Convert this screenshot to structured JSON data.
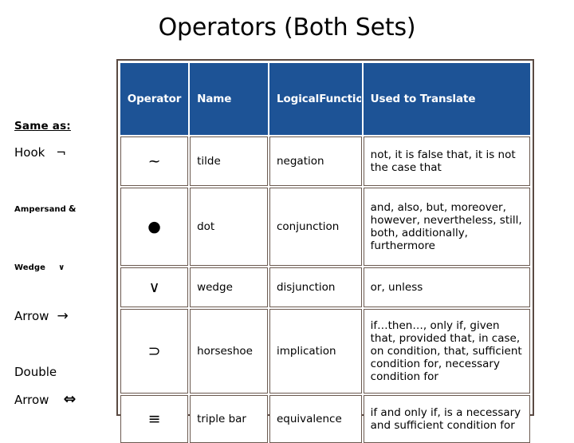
{
  "slide": {
    "title": "Operators (Both Sets)"
  },
  "annotations": {
    "heading": "Same as:",
    "items": [
      {
        "label": "Hook",
        "symbol": "¬"
      },
      {
        "label": "Ampersand",
        "symbol": "&"
      },
      {
        "label": "Wedge",
        "symbol": "∨"
      },
      {
        "label": "Arrow",
        "symbol": "→"
      },
      {
        "label_line1": "Double",
        "label_line2": "Arrow",
        "symbol": "⇔"
      }
    ]
  },
  "table": {
    "headers": [
      "Operator",
      "Name",
      "Logical\nFunction",
      "Used to Translate"
    ],
    "header_bg": "#1d5396",
    "header_fg": "#ffffff",
    "rows": [
      {
        "operator": "~",
        "name": "tilde",
        "logical_function": "negation",
        "used_to_translate": "not, it is false that, it is not the case that"
      },
      {
        "operator": "●",
        "name": "dot",
        "logical_function": "conjunction",
        "used_to_translate": "and, also, but, moreover, however, nevertheless, still, both, additionally, furthermore"
      },
      {
        "operator": "∨",
        "name": "wedge",
        "logical_function": "disjunction",
        "used_to_translate": "or, unless"
      },
      {
        "operator": "⊃",
        "name": "horseshoe",
        "logical_function": "implication",
        "used_to_translate": "if…then…, only if, given that, provided that, in case, on condition, that, sufficient condition for, necessary condition for"
      },
      {
        "operator": "≡",
        "name": "triple bar",
        "logical_function": "equivalence",
        "used_to_translate": "if and only if, is a necessary and sufficient condition for"
      }
    ]
  }
}
